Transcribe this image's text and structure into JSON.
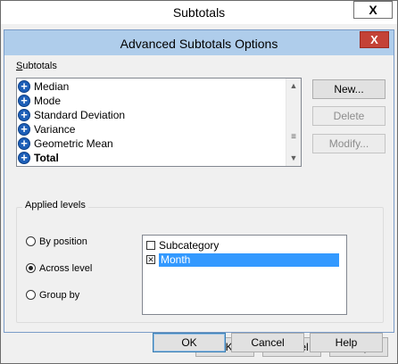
{
  "parent": {
    "title": "Subtotals",
    "close_glyph": "X",
    "ok_label": "OK",
    "cancel_label": "Cancel",
    "help_label": "Help"
  },
  "dialog": {
    "title": "Advanced Subtotals Options",
    "close_glyph": "X",
    "subtotals_label_underline": "S",
    "subtotals_label_rest": "ubtotals",
    "subtotal_items": [
      {
        "label": "Median",
        "icon": "plus-circle-icon"
      },
      {
        "label": "Mode",
        "icon": "plus-circle-icon"
      },
      {
        "label": "Standard Deviation",
        "icon": "plus-circle-icon"
      },
      {
        "label": "Variance",
        "icon": "plus-circle-icon"
      },
      {
        "label": "Geometric Mean",
        "icon": "plus-circle-icon"
      },
      {
        "label": "Total",
        "icon": "plus-circle-icon"
      }
    ],
    "new_label": "New...",
    "delete_label": "Delete",
    "modify_label": "Modify...",
    "applied_levels_label": "Applied levels",
    "radios": [
      {
        "label": "By position",
        "checked": false
      },
      {
        "label": "Across level",
        "checked": true
      },
      {
        "label": "Group by",
        "checked": false
      }
    ],
    "levels": [
      {
        "label": "Subcategory",
        "checked": false,
        "selected": false
      },
      {
        "label": "Month",
        "checked": true,
        "selected": true
      }
    ],
    "ok_label": "OK",
    "cancel_label": "Cancel",
    "help_label": "Help"
  },
  "glyphs": {
    "plus": "+",
    "scroll_up": "▲",
    "scroll_down": "▼",
    "scroll_thumb": "≡",
    "check": "✕"
  },
  "colors": {
    "dialog_titlebar": "#afcdeb",
    "close_button": "#c44237",
    "selection": "#3399ff",
    "plus_icon": "#1d5fb8"
  }
}
